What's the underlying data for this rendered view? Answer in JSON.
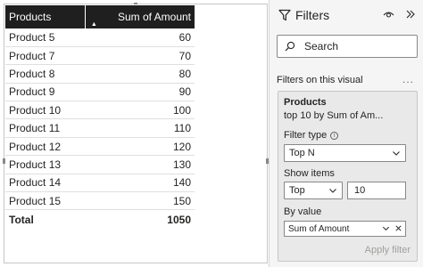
{
  "table": {
    "headers": {
      "products": "Products",
      "amount": "Sum of Amount"
    },
    "rows": [
      {
        "product": "Product 5",
        "amount": "60"
      },
      {
        "product": "Product 7",
        "amount": "70"
      },
      {
        "product": "Product 8",
        "amount": "80"
      },
      {
        "product": "Product 9",
        "amount": "90"
      },
      {
        "product": "Product 10",
        "amount": "100"
      },
      {
        "product": "Product 11",
        "amount": "110"
      },
      {
        "product": "Product 12",
        "amount": "120"
      },
      {
        "product": "Product 13",
        "amount": "130"
      },
      {
        "product": "Product 14",
        "amount": "140"
      },
      {
        "product": "Product 15",
        "amount": "150"
      }
    ],
    "total": {
      "label": "Total",
      "amount": "1050"
    }
  },
  "filters": {
    "title": "Filters",
    "search_label": "Search",
    "section_label": "Filters on this visual",
    "section_more": "...",
    "card": {
      "title": "Products",
      "subtitle": "top 10 by Sum of Am...",
      "filter_type_label": "Filter type",
      "filter_type_value": "Top N",
      "show_items_label": "Show items",
      "show_items_direction": "Top",
      "show_items_count": "10",
      "by_value_label": "By value",
      "by_value_field": "Sum of Amount",
      "apply_label": "Apply filter"
    }
  },
  "colors": {
    "header_bg": "#1f1f1f",
    "pane_bg": "#f5f5f5",
    "card_bg": "#e9e9e9",
    "total_line": "#3a7bd5"
  }
}
